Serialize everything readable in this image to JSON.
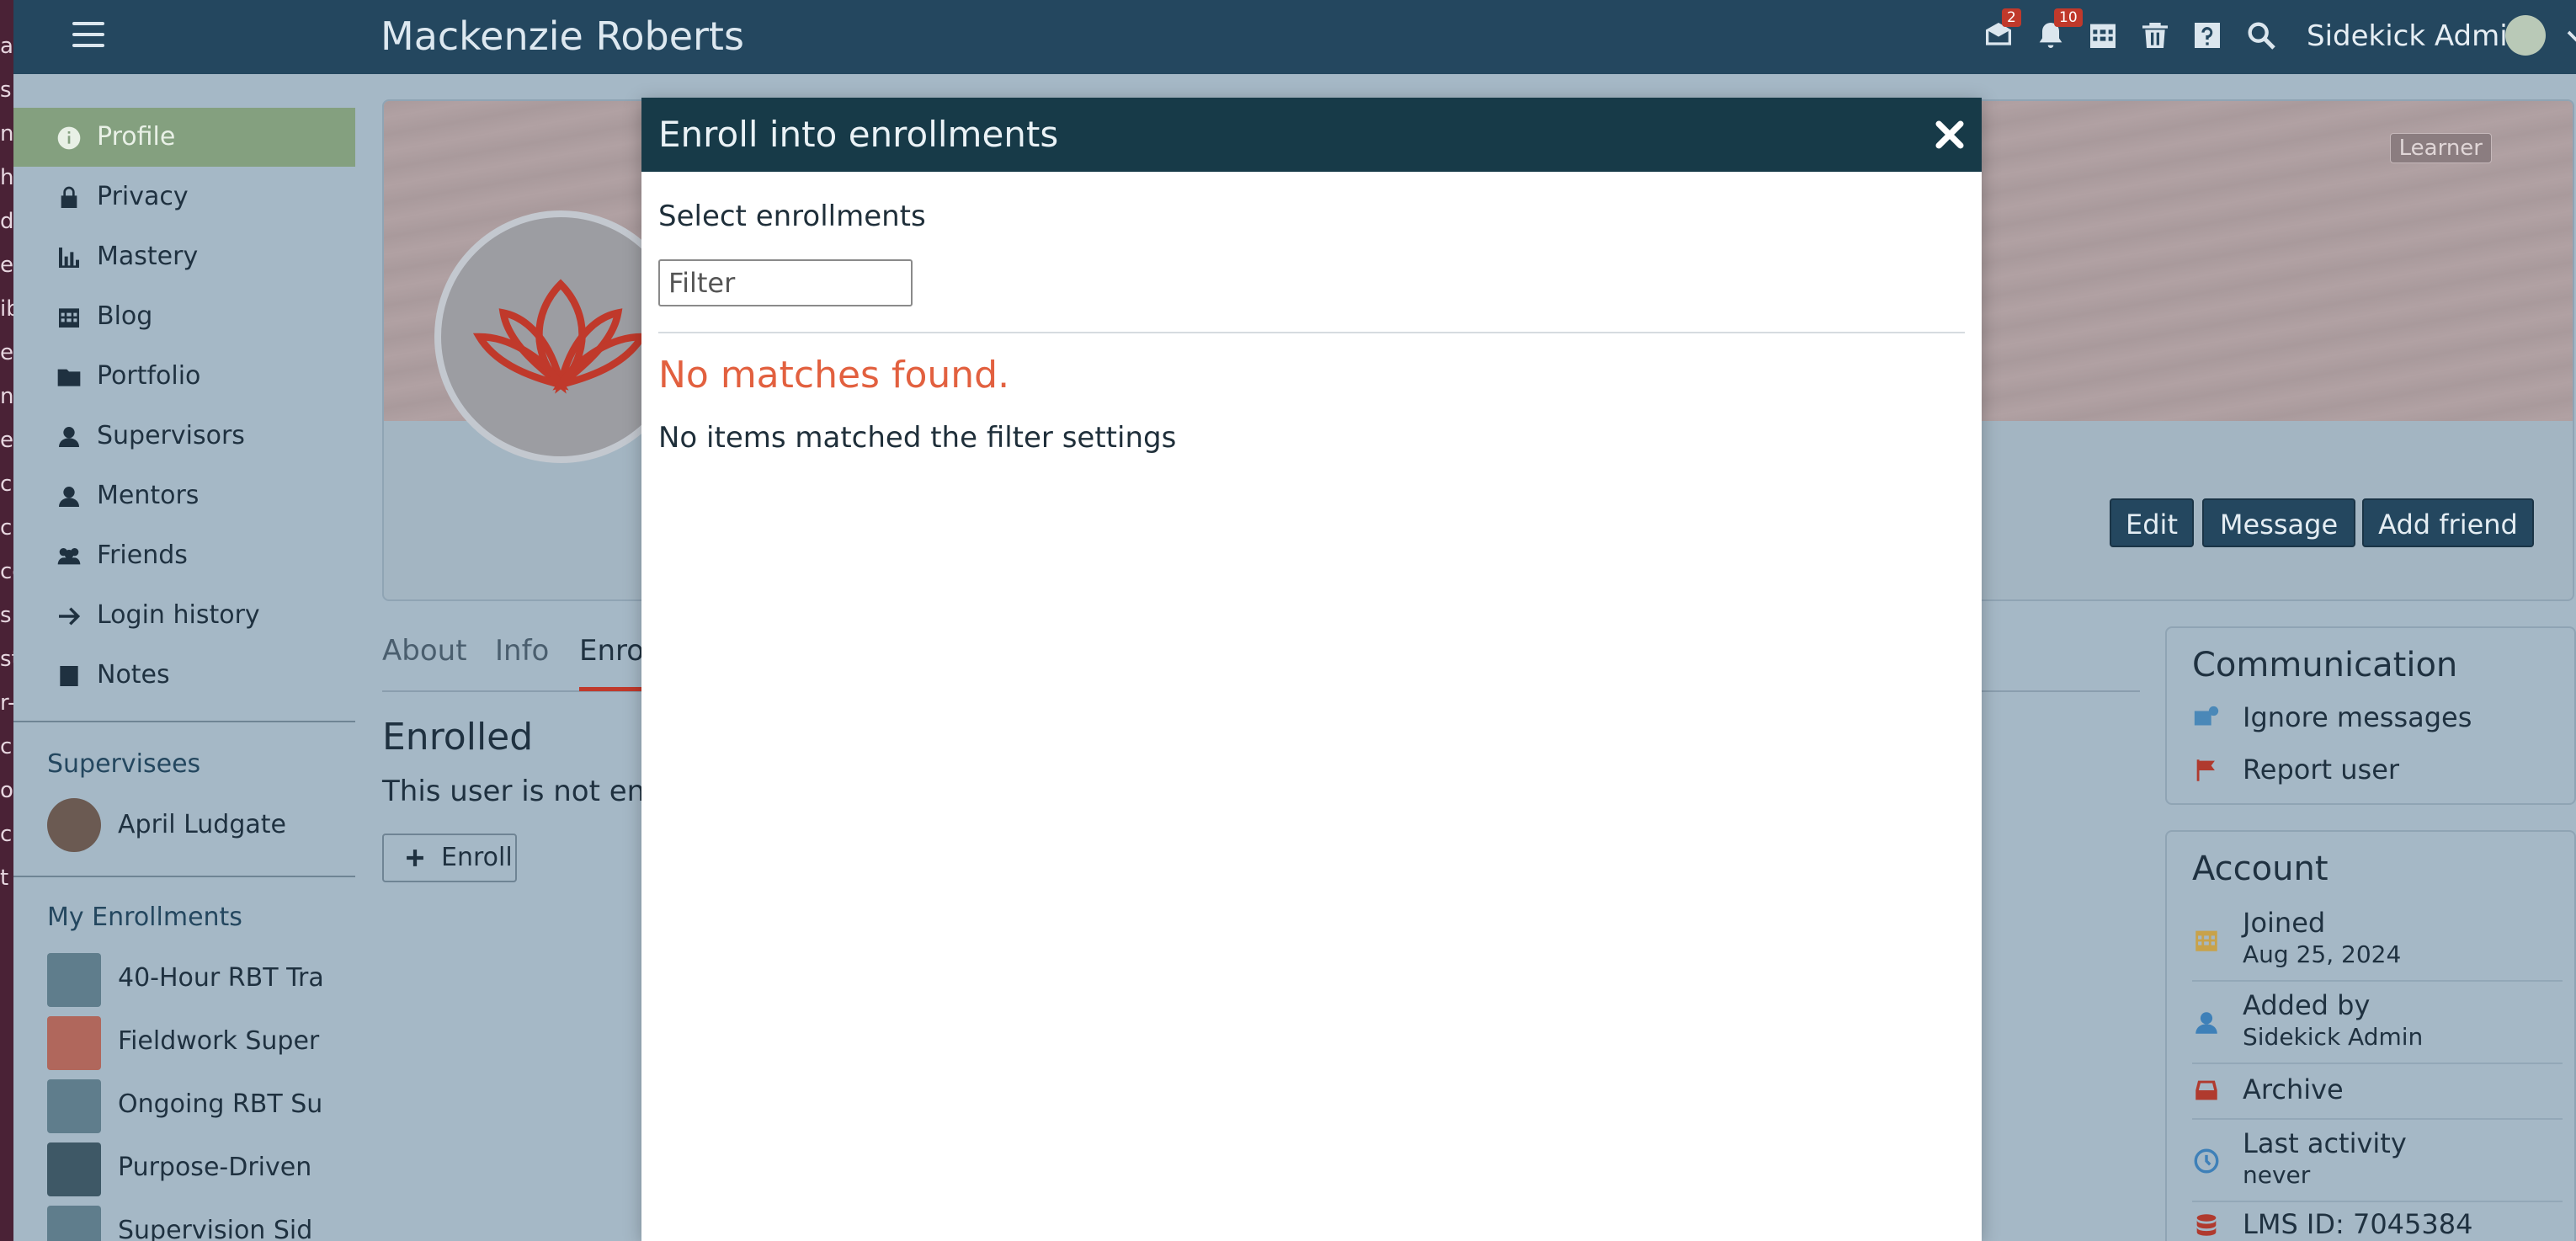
{
  "left_strip": {
    "fragments": [
      "ac",
      "s",
      "n",
      "hc",
      "d",
      "e",
      "ib",
      "er",
      "n",
      "es",
      "c",
      "ci",
      "cc",
      "s",
      "st-",
      "r-",
      "cl",
      "or",
      "ch",
      "t"
    ]
  },
  "topnav": {
    "title": "Mackenzie Roberts",
    "messages_badge": "2",
    "notifications_badge": "10",
    "user_name": "Sidekick Admin",
    "icons": [
      "menu-icon",
      "messages-icon",
      "bell-icon",
      "calendar-icon",
      "trash-icon",
      "help-icon",
      "search-icon",
      "chevron-down-icon"
    ]
  },
  "sidebar": {
    "items": [
      {
        "label": "Profile",
        "icon": "info-icon",
        "active": true
      },
      {
        "label": "Privacy",
        "icon": "lock-icon"
      },
      {
        "label": "Mastery",
        "icon": "bar-chart-icon"
      },
      {
        "label": "Blog",
        "icon": "calendar-icon"
      },
      {
        "label": "Portfolio",
        "icon": "folder-icon"
      },
      {
        "label": "Supervisors",
        "icon": "user-icon"
      },
      {
        "label": "Mentors",
        "icon": "user-icon"
      },
      {
        "label": "Friends",
        "icon": "users-icon"
      },
      {
        "label": "Login history",
        "icon": "arrow-right-icon"
      },
      {
        "label": "Notes",
        "icon": "note-icon"
      }
    ],
    "supervisees_heading": "Supervisees",
    "supervisees": [
      {
        "name": "April Ludgate"
      }
    ],
    "enrollments_heading": "My Enrollments",
    "enrollments": [
      {
        "label": "40-Hour RBT Tra",
        "thumb_color": "#5f7d8c"
      },
      {
        "label": "Fieldwork Super",
        "thumb_color": "#b0675c"
      },
      {
        "label": "Ongoing RBT Su",
        "thumb_color": "#5f7d8c"
      },
      {
        "label": "Purpose-Driven",
        "thumb_color": "#3e5866"
      },
      {
        "label": "Supervision Sid",
        "thumb_color": "#5f7d8c"
      }
    ]
  },
  "profile": {
    "role_tag": "Learner",
    "buttons": {
      "edit": "Edit",
      "message": "Message",
      "add_friend": "Add friend"
    },
    "tabs": [
      "About",
      "Info",
      "Enrol"
    ],
    "active_tab_index": 2,
    "enrolled_title": "Enrolled",
    "enrolled_text": "This user is not enro",
    "enroll_button": "Enroll"
  },
  "communication": {
    "heading": "Communication",
    "items": [
      {
        "label": "Ignore messages",
        "icon": "ignore-messages-icon"
      },
      {
        "label": "Report user",
        "icon": "flag-icon"
      }
    ]
  },
  "account": {
    "heading": "Account",
    "joined_label": "Joined",
    "joined_value": "Aug 25, 2024",
    "added_by_label": "Added by",
    "added_by_value": "Sidekick Admin",
    "archive_label": "Archive",
    "last_activity_label": "Last activity",
    "last_activity_value": "never",
    "lms_id": "LMS ID: 7045384"
  },
  "modal": {
    "title": "Enroll into enrollments",
    "select_label": "Select enrollments",
    "filter_placeholder": "Filter",
    "filter_value": "",
    "no_matches_title": "No matches found.",
    "no_matches_text": "No items matched the filter settings"
  },
  "colors": {
    "nav": "#24475f",
    "sidebar_active": "#84a07f",
    "accent": "#c0392b",
    "modal_header": "#173a48",
    "warning_text": "#e2603f"
  }
}
